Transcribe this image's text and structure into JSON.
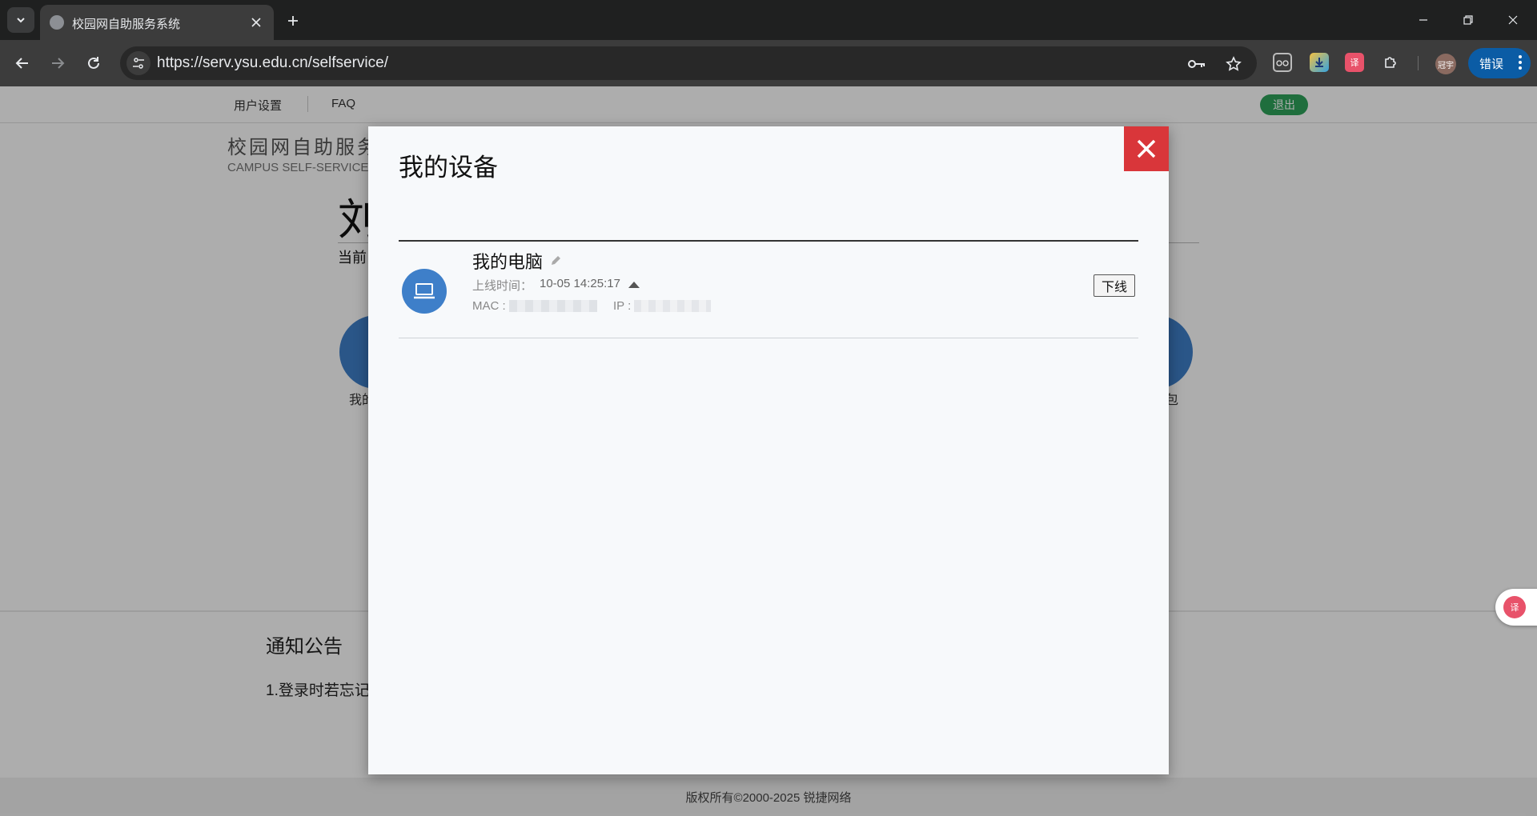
{
  "browser": {
    "tab_title": "校园网自助服务系统",
    "url": "https://serv.ysu.edu.cn/selfservice/",
    "profile_label": "冠宇",
    "error_button_label": "错误"
  },
  "topnav": {
    "user_settings": "用户设置",
    "faq": "FAQ",
    "logout": "退出"
  },
  "brand": {
    "title_cn": "校园网自助服务",
    "title_en": "CAMPUS SELF-SERVICE"
  },
  "background": {
    "big_name": "刘",
    "current_label": "当前",
    "left_label": "我的",
    "right_label": "油包",
    "notice_title": "通知公告",
    "notice_item": "1.登录时若忘记",
    "copyright": "版权所有©2000-2025 锐捷网络"
  },
  "modal": {
    "title": "我的设备",
    "device": {
      "name": "我的电脑",
      "online_time_label": "上线时间：",
      "online_time": "10-05 14:25:17",
      "mac_label": "MAC :",
      "ip_label": "IP :"
    },
    "offline_button": "下线"
  },
  "colors": {
    "accent_blue": "#3e7fc9",
    "close_red": "#d9363a",
    "logout_green": "#2ea35a"
  }
}
